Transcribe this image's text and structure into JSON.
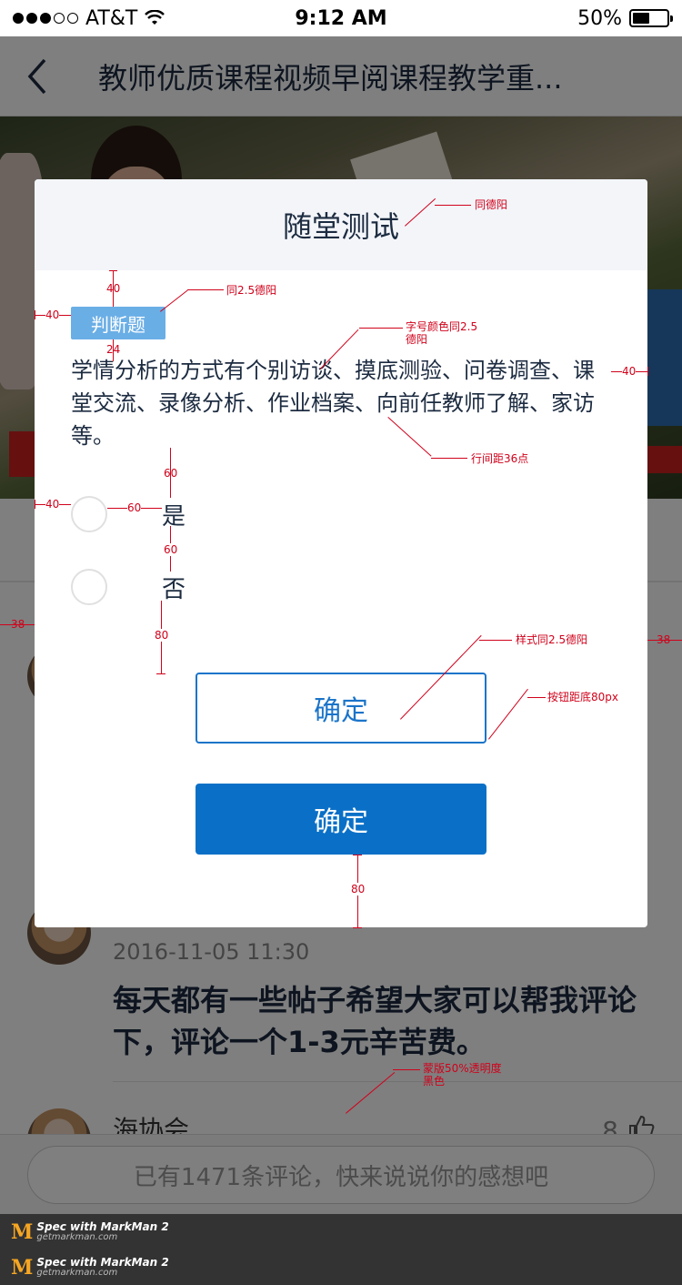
{
  "status": {
    "carrier": "AT&T",
    "time": "9:12 AM",
    "battery": "50%"
  },
  "nav": {
    "title": "教师优质课程视频早阅课程教学重..."
  },
  "comments": [
    {
      "user": "",
      "time": "2016-11-05 11:30",
      "text": "每天都有一些帖子希望大家可以帮我评论下，评论一个1-3元辛苦费。",
      "likes": ""
    },
    {
      "user": "海协会",
      "likes": "8"
    }
  ],
  "bottom": {
    "placeholder": "已有1471条评论，快来说说你的感想吧"
  },
  "dialog": {
    "title": "随堂测试",
    "tag": "判断题",
    "question": "学情分析的方式有个别访谈、摸底测验、问卷调查、课堂交流、录像分析、作业档案、向前任教师了解、家访等。",
    "options": [
      "是",
      "否"
    ],
    "confirm_outline": "确定",
    "confirm_solid": "确定"
  },
  "annotations": {
    "title_note": "同德阳",
    "tag_note": "同2.5德阳",
    "font_note_1": "字号颜色同2.5",
    "font_note_2": "德阳",
    "line_note": "行间距36点",
    "style_note": "样式同2.5德阳",
    "bottom_note": "按钮距底80px",
    "mask_note_1": "蒙版50%透明度",
    "mask_note_2": "黑色",
    "m40a": "40",
    "m40b": "40",
    "m40c": "40",
    "m24": "24",
    "m60a": "60",
    "m60b": "60",
    "m60c": "60",
    "m80a": "80",
    "m80b": "80",
    "m38a": "38",
    "m38b": "38"
  },
  "watermark": {
    "brand": "Spec with MarkMan 2",
    "site": "getmarkman.com"
  }
}
